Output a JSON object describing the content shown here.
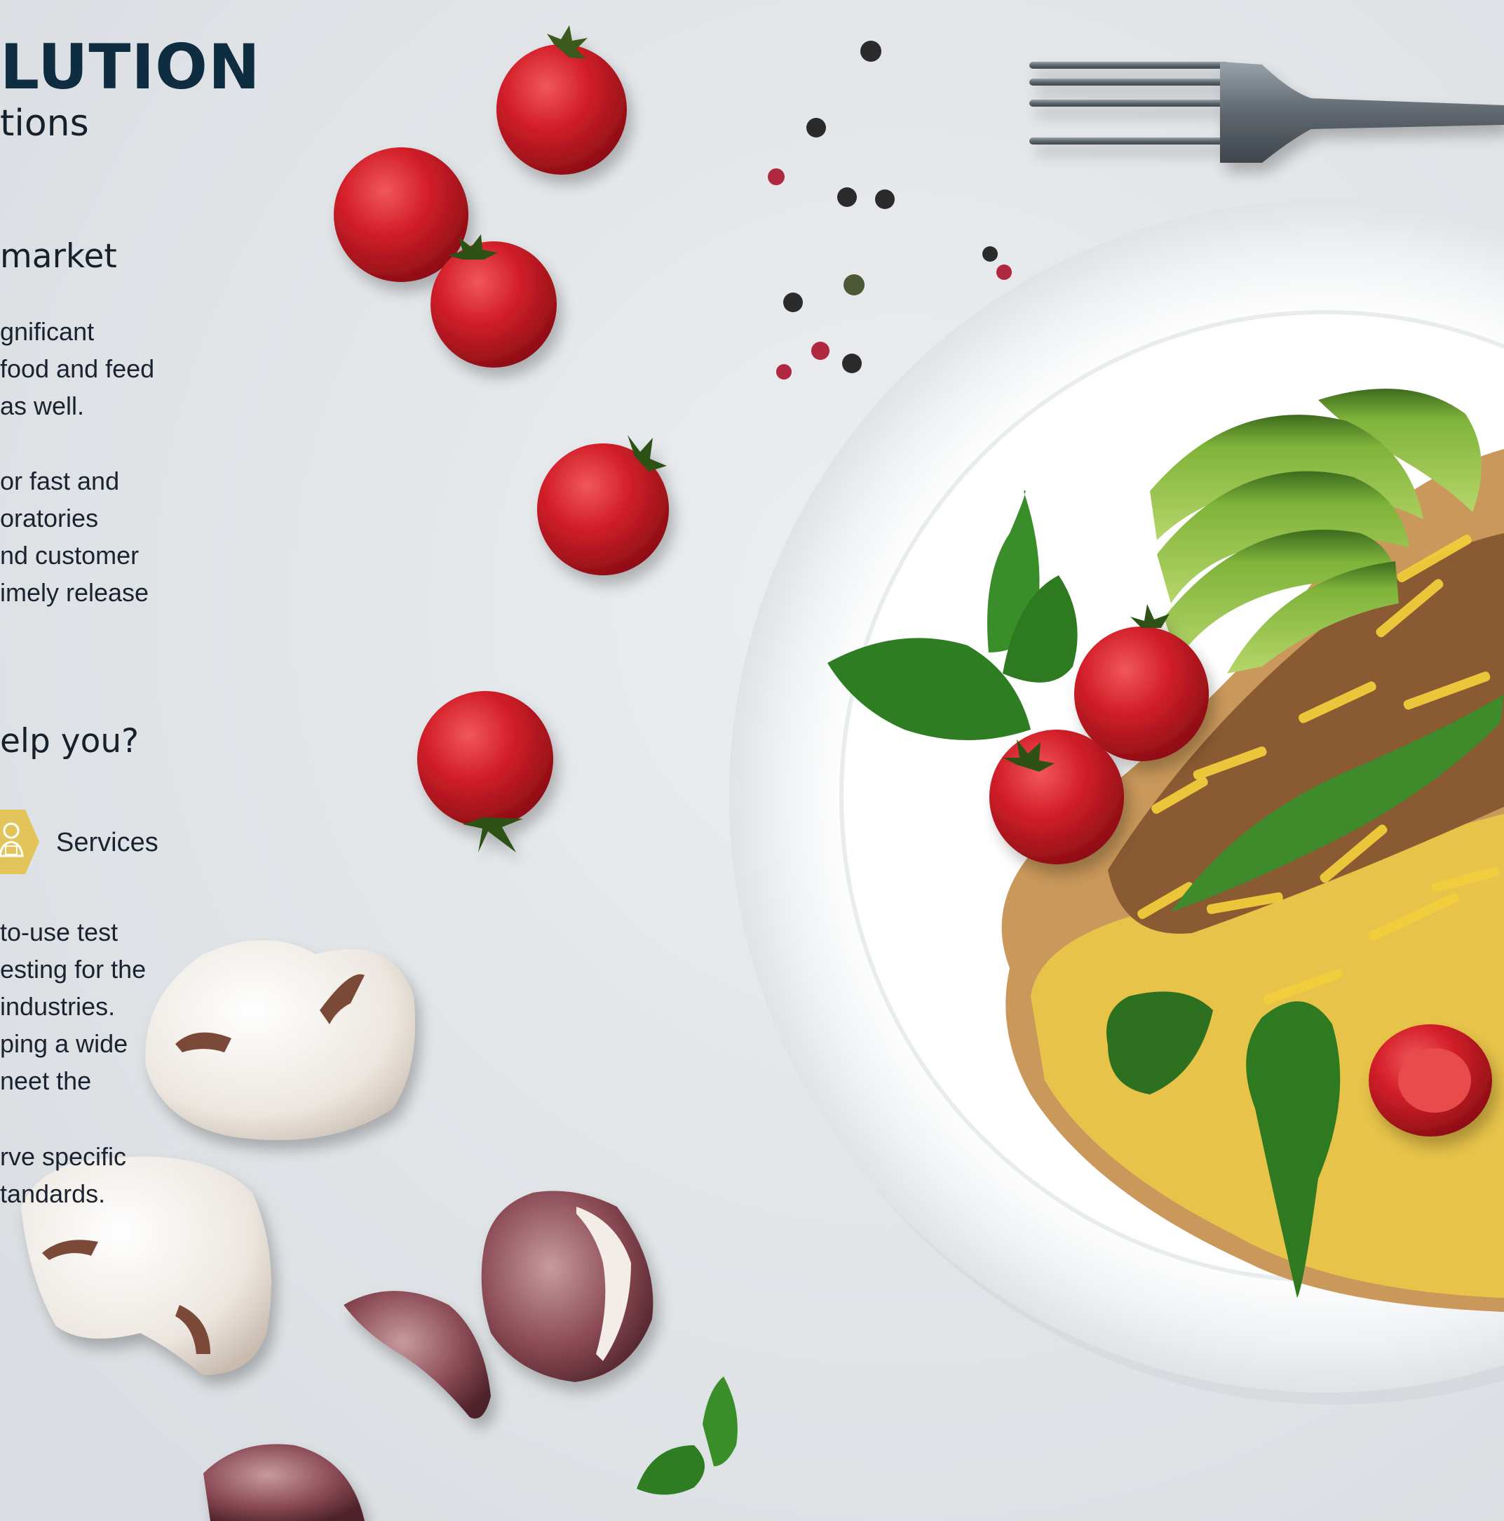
{
  "header": {
    "title": "LUTION",
    "subtitle": "tions"
  },
  "section_market": {
    "heading": "market",
    "paragraph1": [
      "gnificant",
      " food and feed",
      "as well."
    ],
    "paragraph2": [
      "or fast and",
      "oratories",
      "nd customer",
      "imely release"
    ]
  },
  "section_help": {
    "heading": "elp you?",
    "badge_icon": "services-person-icon",
    "badge_color": "#e3c45a",
    "services_label": "Services",
    "paragraph1": [
      "to-use test",
      "esting for the",
      "industries.",
      "ping a wide",
      "neet the"
    ],
    "paragraph2": [
      "rve specific",
      "tandards."
    ]
  },
  "colors": {
    "background": "#e4e7ea",
    "title": "#0e2d40",
    "tomato": "#d4202a",
    "plate": "#f6f8f9",
    "avocado": "#8fbf3a",
    "cheese": "#f2cd3c"
  },
  "image_icons": [
    "tomato-icon",
    "peppercorn-icon",
    "fork-icon",
    "plate-icon",
    "omelette-icon",
    "avocado-icon",
    "basil-icon",
    "mushroom-icon",
    "garlic-icon"
  ]
}
